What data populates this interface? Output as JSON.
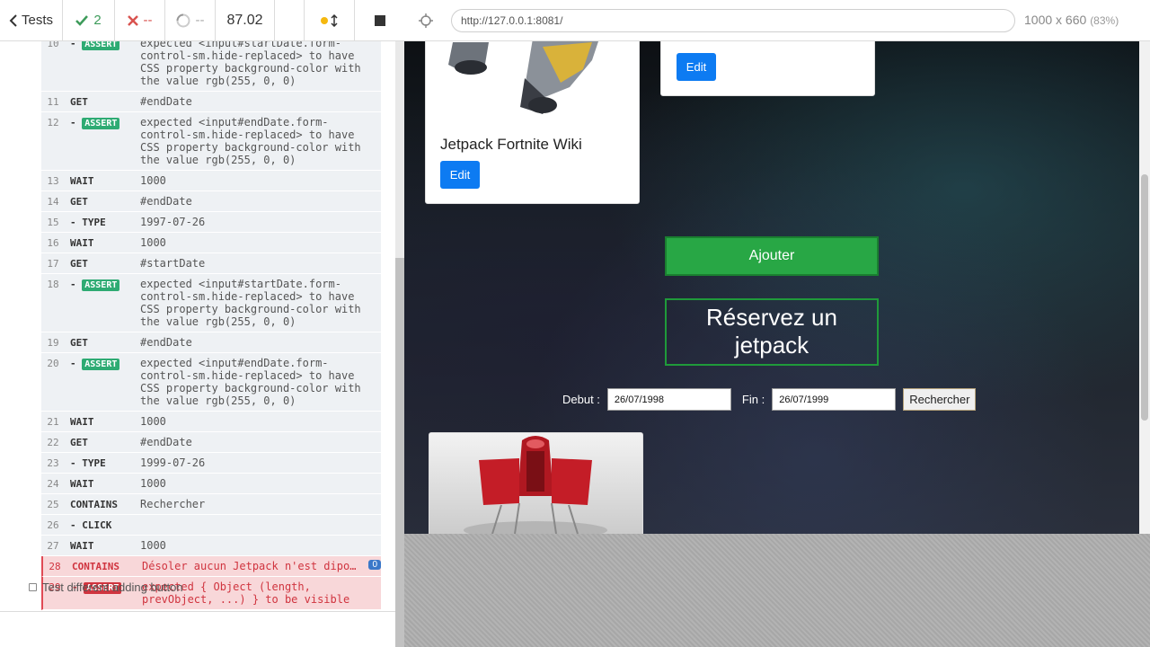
{
  "reporter": {
    "tests_label": "Tests",
    "passed_count": "2",
    "failed_count": "--",
    "pending_count": "--",
    "duration": "87.02",
    "commands": [
      {
        "num": "10",
        "name": "- ASSERT",
        "kind": "assert",
        "msg": "expected <input#startDate.form-control-sm.hide-replaced> to have CSS property background-color with the value rgb(255, 0, 0)"
      },
      {
        "num": "11",
        "name": "GET",
        "kind": "cmd",
        "msg": "#endDate"
      },
      {
        "num": "12",
        "name": "- ASSERT",
        "kind": "assert",
        "msg": "expected <input#endDate.form-control-sm.hide-replaced> to have CSS property background-color with the value rgb(255, 0, 0)"
      },
      {
        "num": "13",
        "name": "WAIT",
        "kind": "cmd",
        "msg": "1000"
      },
      {
        "num": "14",
        "name": "GET",
        "kind": "cmd",
        "msg": "#endDate"
      },
      {
        "num": "15",
        "name": "- TYPE",
        "kind": "cmd",
        "msg": "1997-07-26"
      },
      {
        "num": "16",
        "name": "WAIT",
        "kind": "cmd",
        "msg": "1000"
      },
      {
        "num": "17",
        "name": "GET",
        "kind": "cmd",
        "msg": "#startDate"
      },
      {
        "num": "18",
        "name": "- ASSERT",
        "kind": "assert",
        "msg": "expected <input#startDate.form-control-sm.hide-replaced> to have CSS property background-color with the value rgb(255, 0, 0)"
      },
      {
        "num": "19",
        "name": "GET",
        "kind": "cmd",
        "msg": "#endDate"
      },
      {
        "num": "20",
        "name": "- ASSERT",
        "kind": "assert",
        "msg": "expected <input#endDate.form-control-sm.hide-replaced> to have CSS property background-color with the value rgb(255, 0, 0)"
      },
      {
        "num": "21",
        "name": "WAIT",
        "kind": "cmd",
        "msg": "1000"
      },
      {
        "num": "22",
        "name": "GET",
        "kind": "cmd",
        "msg": "#endDate"
      },
      {
        "num": "23",
        "name": "- TYPE",
        "kind": "cmd",
        "msg": "1999-07-26"
      },
      {
        "num": "24",
        "name": "WAIT",
        "kind": "cmd",
        "msg": "1000"
      },
      {
        "num": "25",
        "name": "CONTAINS",
        "kind": "cmd",
        "msg": "Rechercher"
      },
      {
        "num": "26",
        "name": "- CLICK",
        "kind": "cmd",
        "msg": ""
      },
      {
        "num": "27",
        "name": "WAIT",
        "kind": "cmd",
        "msg": "1000"
      },
      {
        "num": "28",
        "name": "CONTAINS",
        "kind": "failed",
        "msg": "Désoler aucun Jetpack n'est dipo…",
        "badge": "0"
      },
      {
        "num": "29",
        "name": "- ASSERT",
        "kind": "failed-assert",
        "msg": "expected { Object (length, prevObject, ...) } to be visible"
      }
    ],
    "test_different_label": "Test different adding button"
  },
  "aut": {
    "url": "http://127.0.0.1:8081/",
    "viewport": "1000 x 660",
    "zoom": "(83%)",
    "card1_title": "Jetpack Fortnite Wiki",
    "edit_label": "Edit",
    "ajouter_label": "Ajouter",
    "reserve_title": "Réservez un jetpack",
    "debut_label": "Debut :",
    "debut_value": "26/07/1998",
    "fin_label": "Fin :",
    "fin_value": "26/07/1999",
    "rechercher_label": "Rechercher"
  },
  "colors": {
    "passed": "#3d9b5a",
    "failed": "#d9534f",
    "assert": "#2eab73",
    "edit_button": "#0d7bf2",
    "ajouter_button": "#28a745"
  }
}
